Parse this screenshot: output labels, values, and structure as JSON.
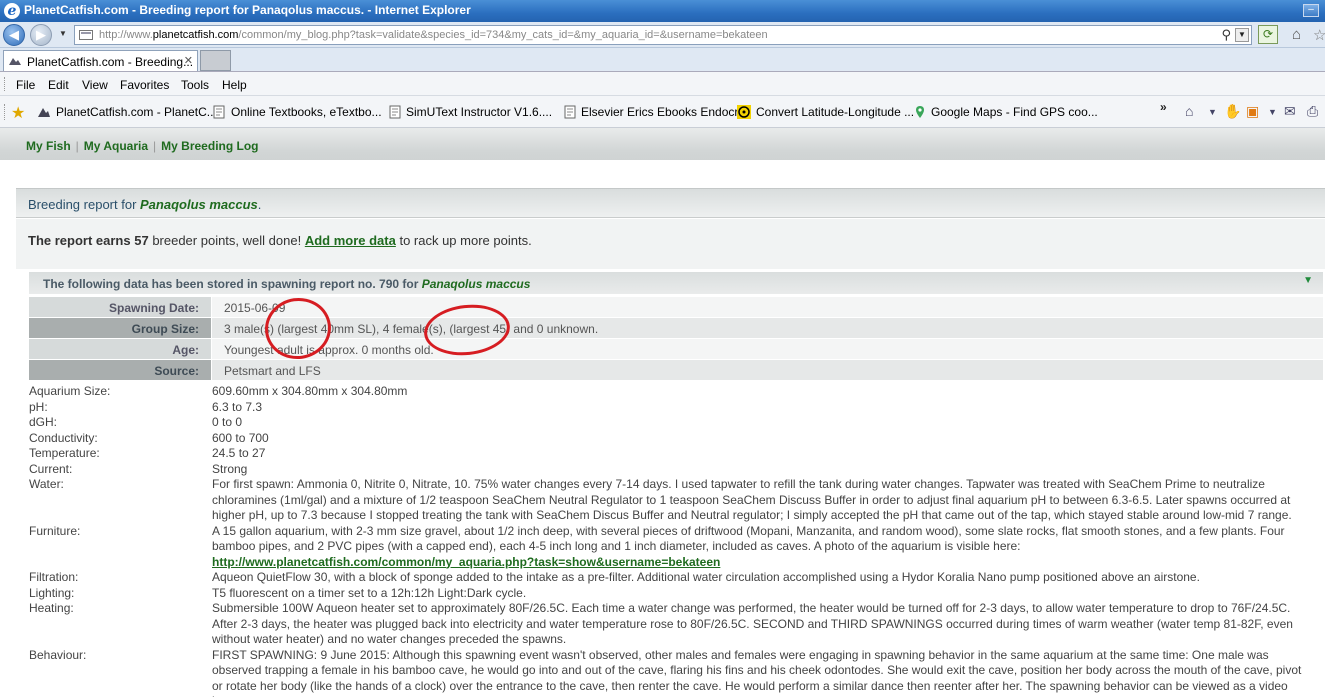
{
  "window": {
    "title": "PlanetCatfish.com - Breeding report for Panaqolus maccus. - Internet Explorer"
  },
  "address_bar": {
    "url_prefix": "http://www.",
    "url_domain": "planetcatfish.com",
    "url_rest": "/common/my_blog.php?task=validate&species_id=734&my_cats_id=&my_aquaria_id=&username=bekateen"
  },
  "tab": {
    "label": "PlanetCatfish.com - Breeding..."
  },
  "menu": [
    "File",
    "Edit",
    "View",
    "Favorites",
    "Tools",
    "Help"
  ],
  "favorites": [
    "PlanetCatfish.com - PlanetC...",
    "Online Textbooks, eTextbo...",
    "SimUText Instructor   V1.6....",
    "Elsevier Erics Ebooks Endocr...",
    "Convert Latitude-Longitude ...",
    "Google Maps - Find GPS coo..."
  ],
  "site_nav": {
    "links": [
      "My Fish",
      "My Aquaria",
      "My Breeding Log"
    ]
  },
  "report": {
    "heading_prefix": "Breeding report for ",
    "species": "Panaqolus maccus",
    "heading_suffix": ".",
    "earn_prefix": "The report earns",
    "earn_points": "57",
    "earn_mid": "breeder points, well done!",
    "earn_link": "Add more data",
    "earn_suffix": "to rack up more points.",
    "stored_prefix": "The following data has been stored in spawning report no. 790 for",
    "stored_species": "Panaqolus maccus"
  },
  "summary": [
    {
      "key": "Spawning Date:",
      "value": "2015-06-09"
    },
    {
      "key": "Group Size:",
      "value": "3 male(s) (largest 40mm SL), 4 female(s), (largest 45) and 0 unknown."
    },
    {
      "key": "Age:",
      "value": "Youngest adult is approx. 0 months old."
    },
    {
      "key": "Source:",
      "value": "Petsmart and LFS"
    }
  ],
  "details": [
    {
      "label": "Aquarium Size:",
      "value": "609.60mm x 304.80mm x 304.80mm"
    },
    {
      "label": "pH:",
      "value": "6.3 to 7.3"
    },
    {
      "label": "dGH:",
      "value": "0 to 0"
    },
    {
      "label": "Conductivity:",
      "value": "600 to 700"
    },
    {
      "label": "Temperature:",
      "value": "24.5 to 27"
    },
    {
      "label": "Current:",
      "value": "Strong"
    },
    {
      "label": "Water:",
      "value": "For first spawn: Ammonia 0, Nitrite 0, Nitrate, 10. 75% water changes every 7-14 days. I used tapwater to refill the tank during water changes. Tapwater was treated with SeaChem Prime to neutralize chloramines (1ml/gal) and a mixture of 1/2 teaspoon SeaChem Neutral Regulator to 1 teaspoon SeaChem Discuss Buffer in order to adjust final aquarium pH to between 6.3-6.5. Later spawns occurred at higher pH, up to 7.3 because I stopped treating the tank with SeaChem Discus Buffer and Neutral regulator; I simply accepted the pH that came out of the tap, which stayed stable around low-mid 7 range."
    },
    {
      "label": "Furniture:",
      "value": "A 15 gallon aquarium, with 2-3 mm size gravel, about 1/2 inch deep, with several pieces of driftwood (Mopani, Manzanita, and random wood), some slate rocks, flat smooth stones, and a few plants. Four bamboo pipes, and 2 PVC pipes (with a capped end), each 4-5 inch long and 1 inch diameter, included as caves. A photo of the aquarium is visible here:",
      "link": "http://www.planetcatfish.com/common/my_aquaria.php?task=show&username=bekateen"
    },
    {
      "label": "Filtration:",
      "value": "Aqueon QuietFlow 30, with a block of sponge added to the intake as a pre-filter. Additional water circulation accomplished using a Hydor Koralia Nano pump positioned above an airstone."
    },
    {
      "label": "Lighting:",
      "value": "T5 fluorescent on a timer set to a 12h:12h Light:Dark cycle."
    },
    {
      "label": "Heating:",
      "value": "Submersible 100W Aqueon heater set to approximately 80F/26.5C. Each time a water change was performed, the heater would be turned off for 2-3 days, to allow water temperature to drop to 76F/24.5C. After 2-3 days, the heater was plugged back into electricity and water temperature rose to 80F/26.5C. SECOND and THIRD SPAWNINGS occurred during times of warm weather (water temp 81-82F, even without water heater) and no water changes preceded the spawns."
    },
    {
      "label": "Behaviour:",
      "value": "FIRST SPAWNING: 9 June 2015: Although this spawning event wasn't observed, other males and females were engaging in spawning behavior in the same aquarium at the same time: One male was observed trapping a female in his bamboo cave, he would go into and out of the cave, flaring his fins and his cheek odontodes. She would exit the cave, position her body across the mouth of the cave, pivot or rotate her body (like the hands of a clock) over the entrance to the cave, then renter the cave. He would perform a similar dance then reenter after her. The spawning behavior can be viewed as a video here:"
    }
  ],
  "colors": {
    "accent_green": "#1f6b1f",
    "annotation_red": "#d61d22",
    "ie_blue": "#2b6fbf"
  }
}
